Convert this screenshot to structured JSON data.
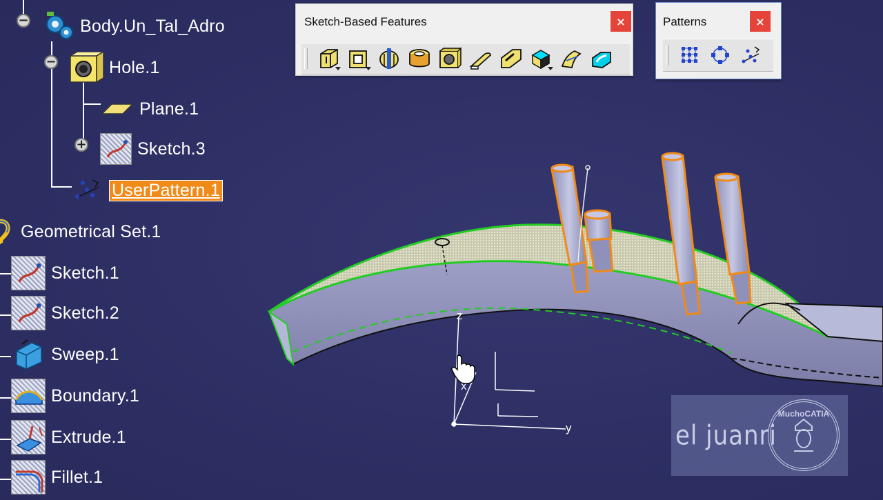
{
  "tree": {
    "body": {
      "label": "Body.Un_Tal_Adro",
      "expander": "−"
    },
    "hole": {
      "label": "Hole.1",
      "expander": "−"
    },
    "plane": {
      "label": "Plane.1"
    },
    "sketch3": {
      "label": "Sketch.3",
      "expander": "+"
    },
    "userpattern": {
      "label": "UserPattern.1"
    },
    "geoset": {
      "label": "Geometrical Set.1"
    },
    "items": [
      {
        "label": "Sketch.1",
        "icon": "sketch-icon"
      },
      {
        "label": "Sketch.2",
        "icon": "sketch-icon"
      },
      {
        "label": "Sweep.1",
        "icon": "sweep-icon"
      },
      {
        "label": "Boundary.1",
        "icon": "boundary-icon"
      },
      {
        "label": "Extrude.1",
        "icon": "extrude-icon"
      },
      {
        "label": "Fillet.1",
        "icon": "fillet-icon"
      }
    ]
  },
  "toolbars": {
    "sketch_based": {
      "title": "Sketch-Based Features",
      "close": "×",
      "tools": [
        "pad-icon",
        "pocket-icon",
        "shaft-icon",
        "groove-icon",
        "hole-icon",
        "rib-icon",
        "slot-icon",
        "stiffener-icon",
        "multi-section-solid-icon",
        "removed-multi-section-solid-icon"
      ]
    },
    "patterns": {
      "title": "Patterns",
      "close": "×",
      "tools": [
        "rectangular-pattern-icon",
        "circular-pattern-icon",
        "user-pattern-icon"
      ]
    }
  },
  "axis": {
    "x": "x",
    "y": "y",
    "z": "z"
  },
  "watermark": {
    "left": "el juanri",
    "seal": "MuchoCATIA"
  },
  "colors": {
    "background": "#2f3166",
    "selection": "#f08a18",
    "highlight_edge": "#22cc22",
    "pin": "#f08a18"
  }
}
